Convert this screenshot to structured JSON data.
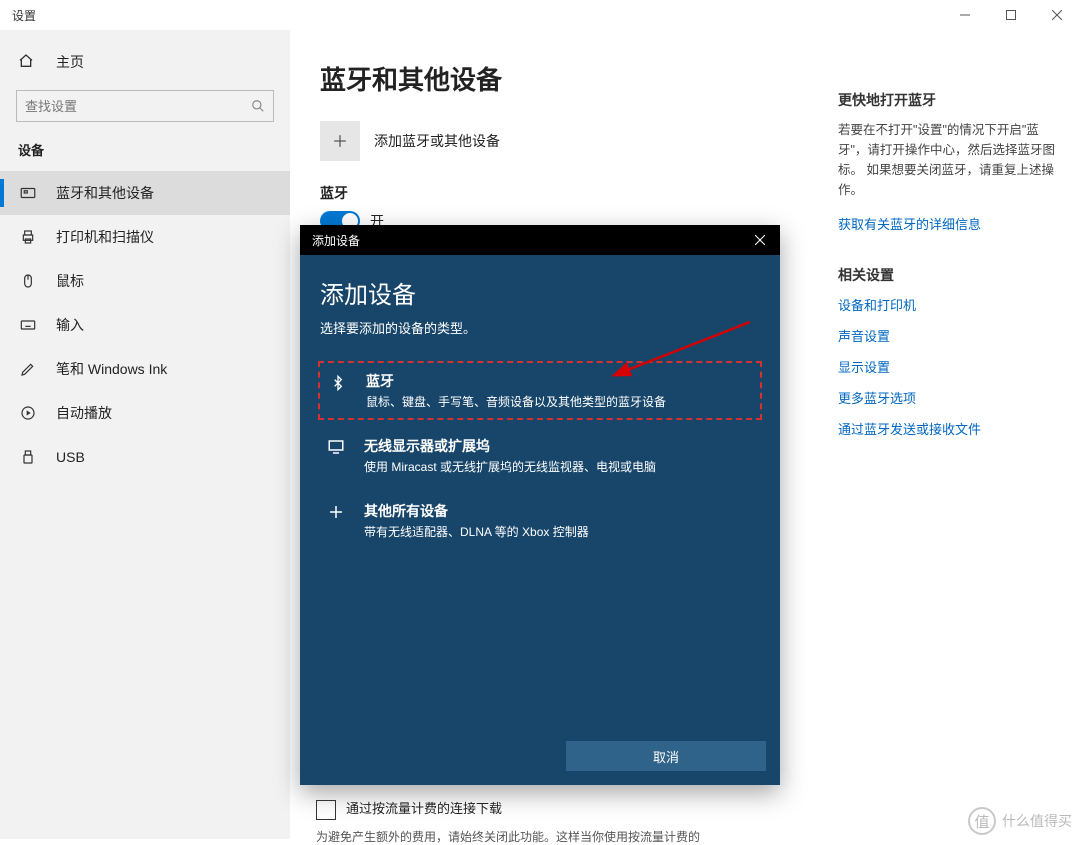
{
  "window": {
    "title": "设置"
  },
  "sidebar": {
    "home": "主页",
    "search_placeholder": "查找设置",
    "category": "设备",
    "items": [
      {
        "label": "蓝牙和其他设备"
      },
      {
        "label": "打印机和扫描仪"
      },
      {
        "label": "鼠标"
      },
      {
        "label": "输入"
      },
      {
        "label": "笔和 Windows Ink"
      },
      {
        "label": "自动播放"
      },
      {
        "label": "USB"
      }
    ]
  },
  "page": {
    "title": "蓝牙和其他设备",
    "add_label": "添加蓝牙或其他设备",
    "bt_section": "蓝牙",
    "bt_toggle": "开"
  },
  "right": {
    "fast_title": "更快地打开蓝牙",
    "fast_text": "若要在不打开\"设置\"的情况下开启\"蓝牙\"，请打开操作中心，然后选择蓝牙图标。 如果想要关闭蓝牙，请重复上述操作。",
    "link_details": "获取有关蓝牙的详细信息",
    "related_title": "相关设置",
    "links": [
      "设备和打印机",
      "声音设置",
      "显示设置",
      "更多蓝牙选项",
      "通过蓝牙发送或接收文件"
    ]
  },
  "dialog": {
    "titlebar": "添加设备",
    "heading": "添加设备",
    "subtitle": "选择要添加的设备的类型。",
    "options": [
      {
        "title": "蓝牙",
        "desc": "鼠标、键盘、手写笔、音频设备以及其他类型的蓝牙设备"
      },
      {
        "title": "无线显示器或扩展坞",
        "desc": "使用 Miracast 或无线扩展坞的无线监视器、电视或电脑"
      },
      {
        "title": "其他所有设备",
        "desc": "带有无线适配器、DLNA 等的 Xbox 控制器"
      }
    ],
    "cancel": "取消"
  },
  "metered": {
    "label": "通过按流量计费的连接下载",
    "note": "为避免产生额外的费用，请始终关闭此功能。这样当你使用按流量计费的"
  },
  "watermark": {
    "char": "值",
    "text": "什么值得买"
  }
}
